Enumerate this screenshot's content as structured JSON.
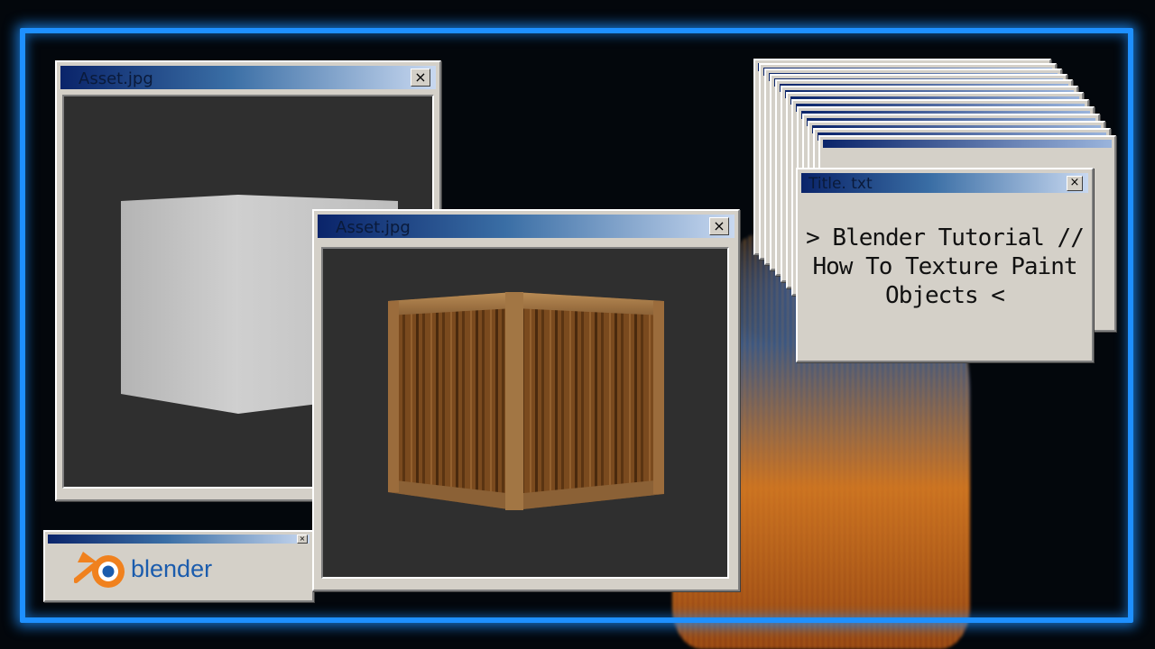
{
  "colors": {
    "neon_frame": "#1e90ff",
    "titlebar_start": "#0a246a",
    "window_face": "#d4d0c8",
    "viewport_bg": "#2f2f2f",
    "logo_orange": "#f0811e",
    "logo_blue": "#1b5cad"
  },
  "windows": {
    "back_asset": {
      "title": "Asset.jpg",
      "close_label": "×"
    },
    "front_asset": {
      "title": "Asset.jpg",
      "close_label": "×"
    },
    "title_txt": {
      "title": "Title. txt",
      "close_label": "×",
      "lines": [
        "> Blender Tutorial //",
        "How To Texture Paint",
        "Objects <"
      ]
    },
    "logo": {
      "brand_text": "blender",
      "close_label": "×"
    }
  },
  "icons": {
    "logo": "blender-logo-icon",
    "close": "close-icon"
  }
}
